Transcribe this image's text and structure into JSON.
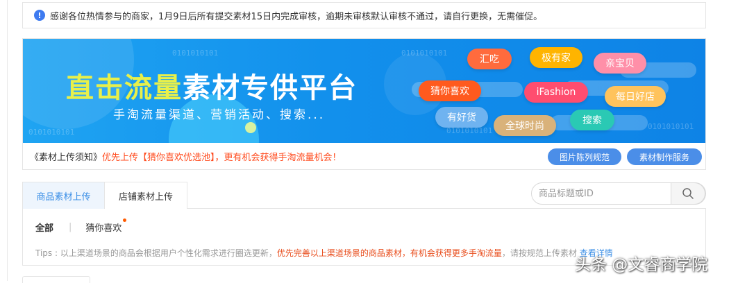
{
  "notice": {
    "icon": "info-icon",
    "text": "感谢各位热情参与的商家，1月9日后所有提交素材15日内完成审核，逾期未审核默认审核不通过，请自行更换，无需催促。"
  },
  "banner": {
    "title_highlight": "直击流量",
    "title_rest": "素材专供平台",
    "subtitle": "手淘流量渠道、营销活动、搜索...",
    "binary_text": "0101010101",
    "tags": [
      "汇吃",
      "极有家",
      "亲宝贝",
      "猜你喜欢",
      "iFashion",
      "每日好店",
      "有好货",
      "全球时尚",
      "搜索"
    ],
    "colors": {
      "background": "#1290ec",
      "title_highlight": "#e8f04a"
    }
  },
  "infobar": {
    "prefix": "《素材上传须知》",
    "highlight": "优先上传【猜你喜欢优选池】，更有机会获得手淘流量机会！",
    "button_display_rules": "图片陈列规范",
    "button_production_service": "素材制作服务"
  },
  "tabs": [
    {
      "label": "商品素材上传",
      "active": true
    },
    {
      "label": "店铺素材上传",
      "active": false
    }
  ],
  "search": {
    "placeholder": "商品标题或ID",
    "icon": "search-icon"
  },
  "filters": {
    "all": "全部",
    "separator": "|",
    "guess": "猜你喜欢"
  },
  "tips": {
    "prefix": "Tips : 以上渠道场景的商品会根据用户个性化需求进行圈选更新，",
    "highlight": "优先完善以上渠道场景的商品素材，有机会获得更多手淘流量",
    "suffix": "，请按规范上传素材 ",
    "link": "查看详情"
  },
  "watermark": "头条 @文睿商学院"
}
